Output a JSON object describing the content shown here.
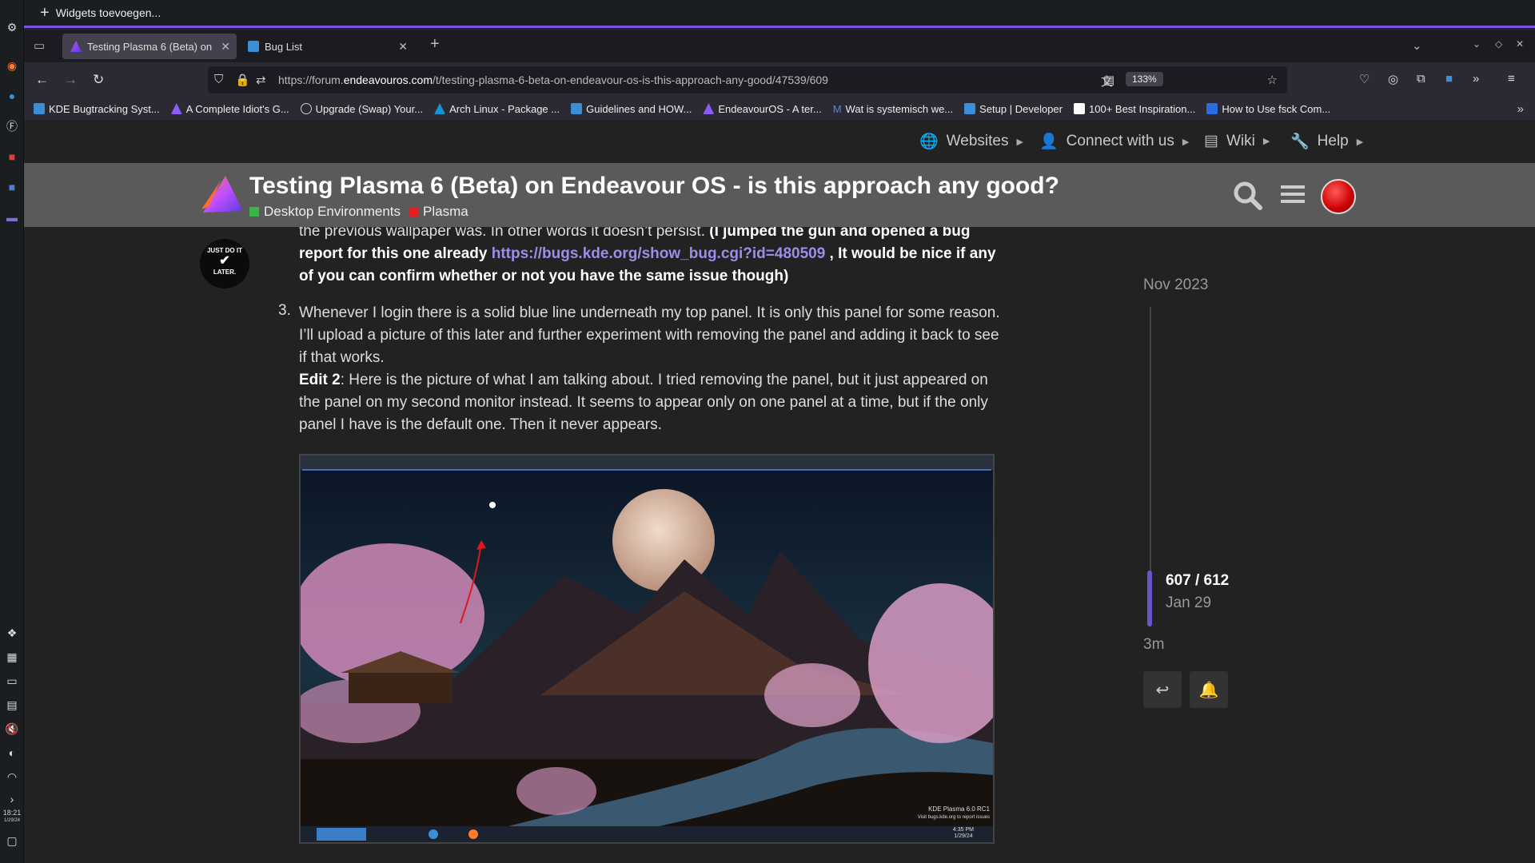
{
  "widget_bar": {
    "label": "Widgets toevoegen..."
  },
  "panel": {
    "clock_time": "18:21",
    "clock_date": "1/29/24"
  },
  "tabs": [
    {
      "label": "Testing Plasma 6 (Beta) on",
      "active": true
    },
    {
      "label": "Bug List",
      "active": false
    }
  ],
  "address": {
    "url_prefix": "https://forum.",
    "url_domain": "endeavouros.com",
    "url_rest": "/t/testing-plasma-6-beta-on-endeavour-os-is-this-approach-any-good/47539/609",
    "zoom": "133%"
  },
  "bookmarks": [
    {
      "label": "KDE Bugtracking Syst...",
      "color": "#3a8fd8"
    },
    {
      "label": "A Complete Idiot's G...",
      "color": "#8a5cf6"
    },
    {
      "label": "Upgrade (Swap) Your...",
      "color": "#888888"
    },
    {
      "label": "Arch Linux - Package ...",
      "color": "#1793d1"
    },
    {
      "label": "Guidelines and HOW...",
      "color": "#3a8fd8"
    },
    {
      "label": "EndeavourOS - A ter...",
      "color": "#8a5cf6"
    },
    {
      "label": "Wat is systemisch we...",
      "color": "#4d8fd6"
    },
    {
      "label": "Setup | Developer",
      "color": "#3a8fd8"
    },
    {
      "label": "100+ Best Inspiration...",
      "color": "#ffffff"
    },
    {
      "label": "How to Use fsck Com...",
      "color": "#2a6de0"
    }
  ],
  "site_nav": {
    "websites": "Websites",
    "connect": "Connect with us",
    "wiki": "Wiki",
    "help": "Help"
  },
  "topic": {
    "title": "Testing Plasma 6 (Beta) on Endeavour OS - is this approach any good?",
    "categories": [
      {
        "name": "Desktop Environments",
        "color": "#3ab54a"
      },
      {
        "name": "Plasma",
        "color": "#e02020"
      }
    ]
  },
  "post": {
    "avatar_line1": "JUST DO IT",
    "avatar_line2": "LATER.",
    "p1_text": "the previous wallpaper was. In other words it doesn’t persist. ",
    "p1_bold1": "(I jumped the gun and opened a bug report for this one already ",
    "p1_link": "https://bugs.kde.org/show_bug.cgi?id=480509",
    "p1_bold2": " , It would be nice if any of you can confirm whether or not you have the same issue though)",
    "item3_number": "3.",
    "item3_text": "Whenever I login there is a solid blue line underneath my top panel. It is only this panel for some reason. I’ll upload a picture of this later and further experiment with removing the panel and adding it back to see if that works.",
    "edit_label": "Edit 2",
    "edit_text": ": Here is the picture of what I am talking about. I tried removing the panel, but it just appeared on the panel on my second monitor instead. It seems to appear only on one panel at a time, but if the only panel I have is the default one. Then it never appears.",
    "screenshot_watermark1": "KDE Plasma 6.0 RC1",
    "screenshot_watermark2": "Visit bugs.kde.org to report issues",
    "screenshot_time": "4:35 PM",
    "screenshot_date": "1/29/24"
  },
  "timeline": {
    "start_date": "Nov 2023",
    "position": "607 / 612",
    "position_value": 607,
    "total": 612,
    "current_date": "Jan 29",
    "last_activity": "3m"
  }
}
